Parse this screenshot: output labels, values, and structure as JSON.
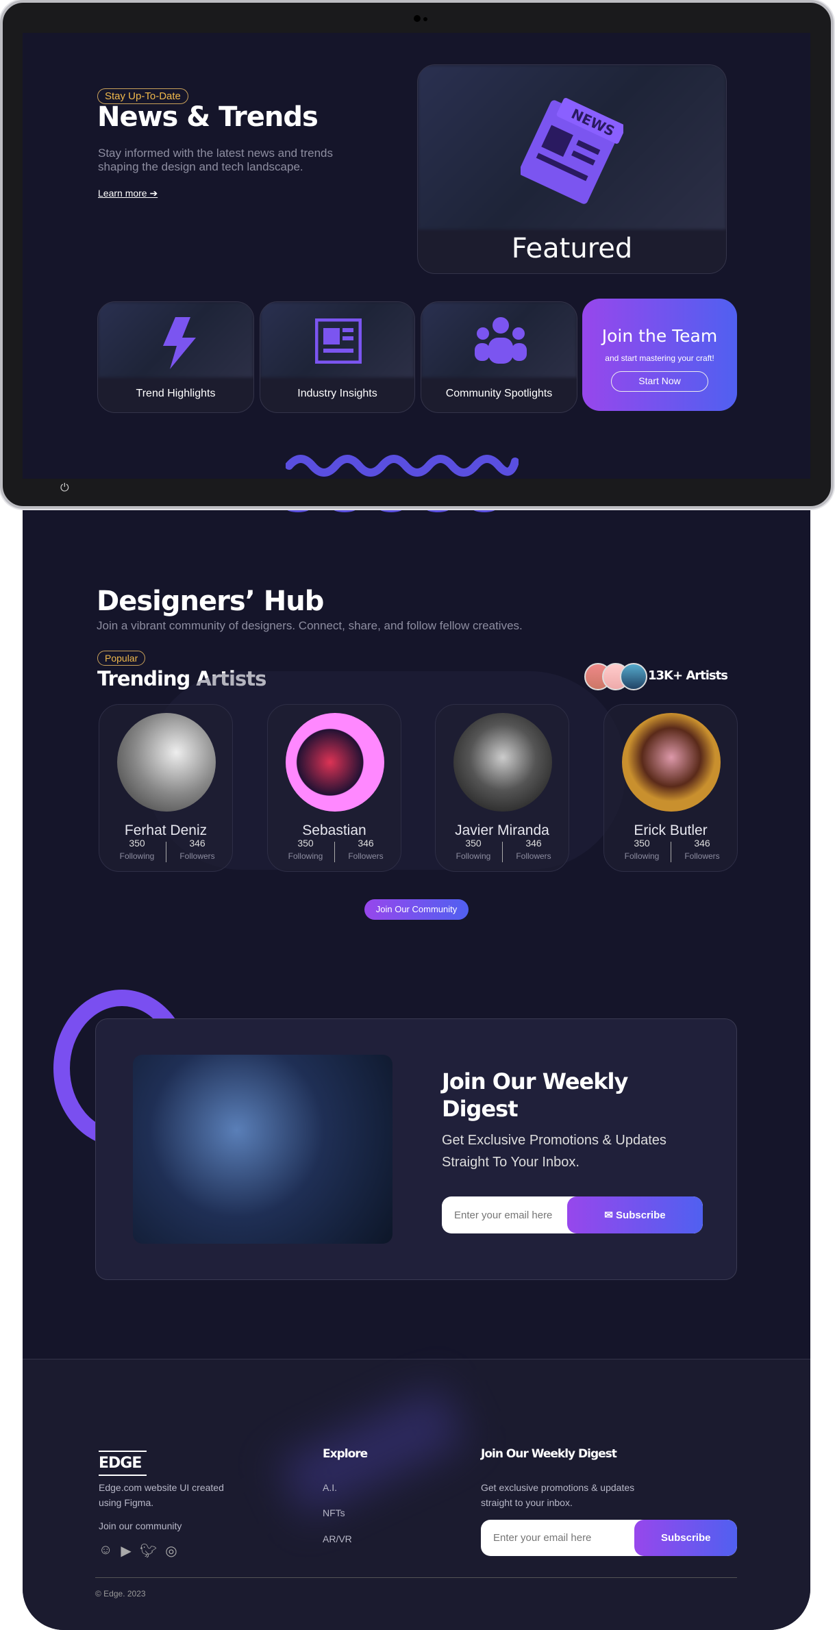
{
  "hero": {
    "badge": "Stay Up-To-Date",
    "title": "News & Trends",
    "description_line1": "Stay informed with the latest news and trends",
    "description_line2": "shaping the design and tech landscape.",
    "learn_more": "Learn more"
  },
  "featured": {
    "label": "Featured",
    "icon": "newspaper-icon",
    "icon_text": "NEWS"
  },
  "categories": [
    {
      "label": "Trend Highlights",
      "icon": "lightning-icon"
    },
    {
      "label": "Industry Insights",
      "icon": "article-icon"
    },
    {
      "label": "Community Spotlights",
      "icon": "people-group-icon"
    }
  ],
  "join_team": {
    "title": "Join the Team",
    "subtitle": "and start mastering your craft!",
    "button": "Start Now"
  },
  "hub": {
    "title": "Designers’ Hub",
    "subtitle": "Join a vibrant community of designers. Connect, share, and follow fellow creatives.",
    "badge": "Popular",
    "section_title": "Trending Artists",
    "artist_count": "13K+ Artists",
    "join_button": "Join Our Community"
  },
  "artists": [
    {
      "name": "Ferhat Deniz",
      "following": "350",
      "following_label": "Following",
      "followers": "346",
      "followers_label": "Followers"
    },
    {
      "name": "Sebastian",
      "following": "350",
      "following_label": "Following",
      "followers": "346",
      "followers_label": "Followers"
    },
    {
      "name": "Javier Miranda",
      "following": "350",
      "following_label": "Following",
      "followers": "346",
      "followers_label": "Followers"
    },
    {
      "name": "Erick Butler",
      "following": "350",
      "following_label": "Following",
      "followers": "346",
      "followers_label": "Followers"
    }
  ],
  "digest": {
    "title_line1": "Join Our Weekly",
    "title_line2": "Digest",
    "desc_line1": "Get Exclusive Promotions & Updates",
    "desc_line2": "Straight To Your Inbox.",
    "placeholder": "Enter your email here",
    "button": "Subscribe"
  },
  "footer": {
    "logo": "EDGE",
    "desc_line1": "Edge.com website UI created",
    "desc_line2": "using Figma.",
    "community": "Join our community",
    "social": [
      "discord-icon",
      "youtube-icon",
      "twitter-icon",
      "instagram-icon"
    ],
    "explore_title": "Explore",
    "explore_links": [
      "A.I.",
      "NFTs",
      "AR/VR"
    ],
    "digest_title": "Join Our Weekly Digest",
    "digest_line1": "Get exclusive promotions & updates",
    "digest_line2": "straight to your inbox.",
    "placeholder": "Enter your email here",
    "button": "Subscribe",
    "copyright": "© Edge. 2023"
  },
  "colors": {
    "accent_start": "#9747ec",
    "accent_end": "#5060f0",
    "badge": "#f0b94c",
    "background": "#15152a"
  }
}
